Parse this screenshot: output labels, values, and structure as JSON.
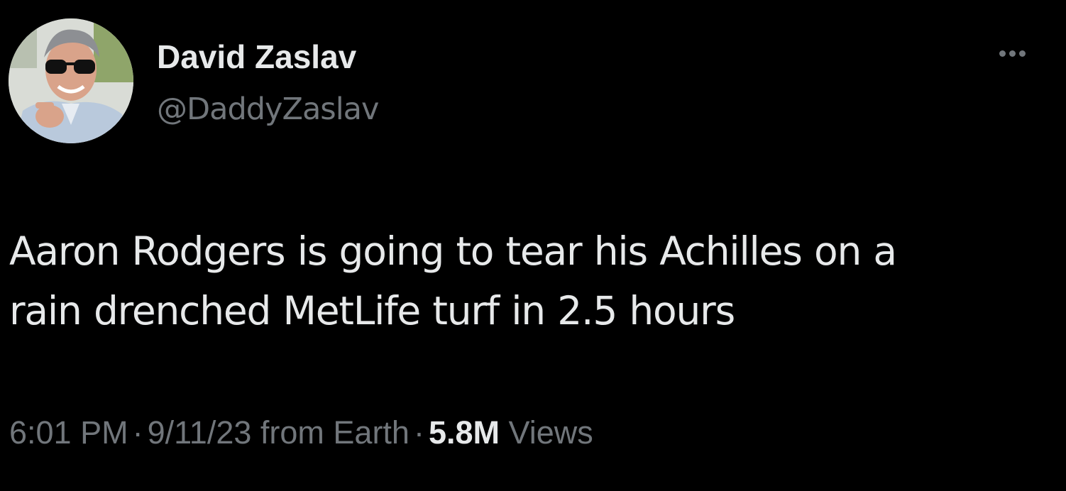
{
  "author": {
    "name": "David Zaslav",
    "handle": "@DaddyZaslav"
  },
  "tweet": {
    "text_lines": [
      "Aaron Rodgers is going to tear his Achilles on a",
      "rain drenched MetLife turf in 2.5 hours"
    ]
  },
  "meta": {
    "time": "6:01 PM",
    "separator": "·",
    "date_source": "9/11/23 from Earth",
    "views_count": "5.8M",
    "views_label": "Views"
  },
  "icons": {
    "more": "more-horizontal-icon"
  },
  "colors": {
    "background": "#000000",
    "primary_text": "#e7e9ea",
    "secondary_text": "#71767b"
  }
}
